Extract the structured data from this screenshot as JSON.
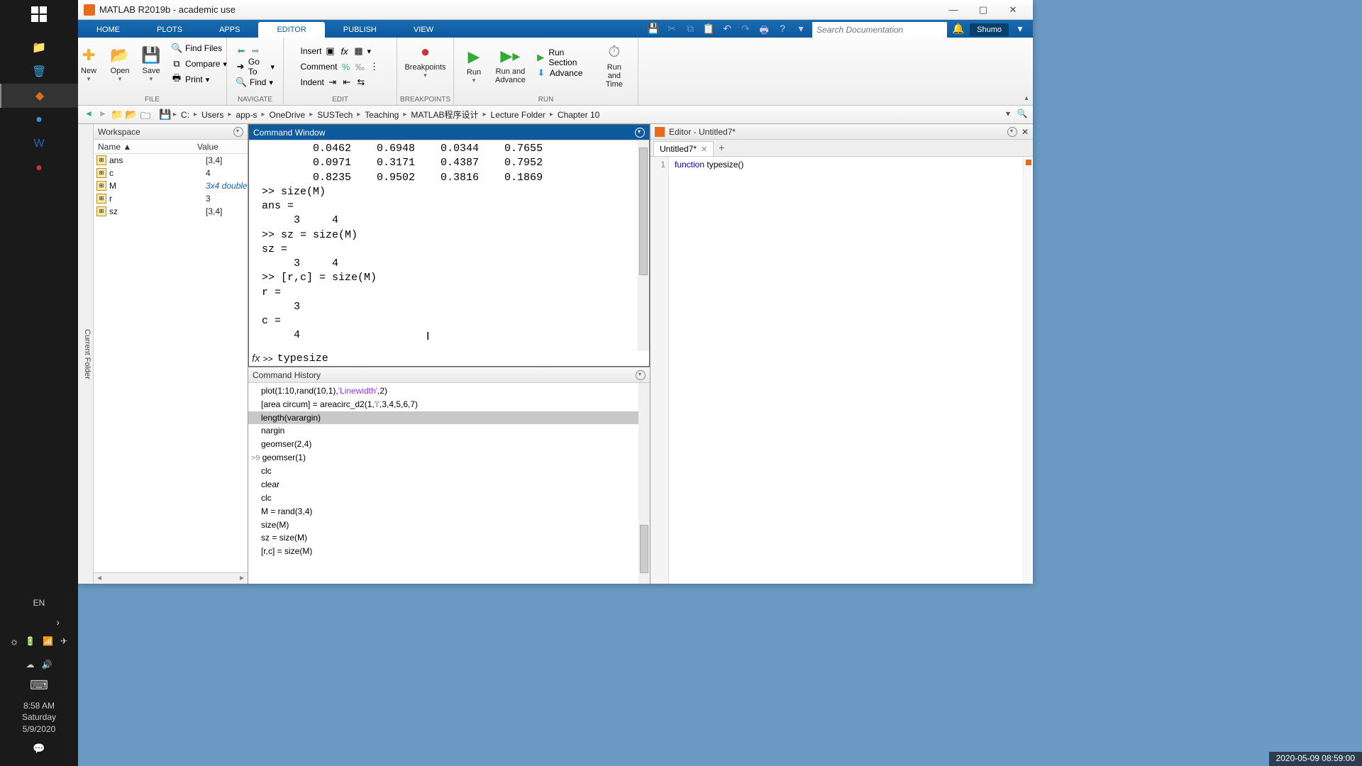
{
  "app": {
    "title": "MATLAB R2019b - academic use"
  },
  "tabs": [
    "HOME",
    "PLOTS",
    "APPS",
    "EDITOR",
    "PUBLISH",
    "VIEW"
  ],
  "active_tab": "EDITOR",
  "search_placeholder": "Search Documentation",
  "user": "Shumo",
  "ribbon": {
    "file": {
      "label": "FILE",
      "new": "New",
      "open": "Open",
      "save": "Save",
      "findfiles": "Find Files",
      "compare": "Compare",
      "print": "Print"
    },
    "navigate": {
      "label": "NAVIGATE",
      "goto": "Go To",
      "find": "Find"
    },
    "edit": {
      "label": "EDIT",
      "insert": "Insert",
      "comment": "Comment",
      "indent": "Indent"
    },
    "breakpoints": {
      "label": "BREAKPOINTS",
      "btn": "Breakpoints"
    },
    "run": {
      "label": "RUN",
      "run": "Run",
      "runadv": "Run and\nAdvance",
      "runsec": "Run Section",
      "advance": "Advance",
      "runtime": "Run and\nTime"
    }
  },
  "breadcrumbs": [
    "C:",
    "Users",
    "app-s",
    "OneDrive",
    "SUSTech",
    "Teaching",
    "MATLAB程序设计",
    "Lecture Folder",
    "Chapter 10"
  ],
  "current_folder_label": "Current Folder",
  "workspace": {
    "title": "Workspace",
    "cols": [
      "Name ▲",
      "Value"
    ],
    "rows": [
      {
        "name": "ans",
        "value": "[3,4]"
      },
      {
        "name": "c",
        "value": "4"
      },
      {
        "name": "M",
        "value": "3x4 double",
        "italic": true
      },
      {
        "name": "r",
        "value": "3"
      },
      {
        "name": "sz",
        "value": "[3,4]"
      }
    ]
  },
  "command_window": {
    "title": "Command Window",
    "lines": [
      "        0.0462    0.6948    0.0344    0.7655",
      "        0.0971    0.3171    0.4387    0.7952",
      "        0.8235    0.9502    0.3816    0.1869",
      ">> size(M)",
      "ans =",
      "     3     4",
      ">> sz = size(M)",
      "sz =",
      "     3     4",
      ">> [r,c] = size(M)",
      "r =",
      "     3",
      "c =",
      "     4"
    ],
    "input_prefix": ">>",
    "input_value": "typesize"
  },
  "command_history": {
    "title": "Command History",
    "items": [
      {
        "text": "plot(1:10,rand(10,1),'Linewidth',2)",
        "strings": [
          "'Linewidth'"
        ]
      },
      {
        "text": "[area circum] = areacirc_d2(1,'i',3,4,5,6,7)",
        "strings": [
          "'i'"
        ]
      },
      {
        "text": "length(varargin)",
        "selected": true
      },
      {
        "text": "nargin"
      },
      {
        "text": "geomser(2,4)"
      },
      {
        "text": "geomser(1)",
        "prefix": ">9"
      },
      {
        "text": "clc"
      },
      {
        "text": "clear"
      },
      {
        "text": "clc"
      },
      {
        "text": "M = rand(3,4)"
      },
      {
        "text": "size(M)"
      },
      {
        "text": "sz = size(M)"
      },
      {
        "text": "[r,c] = size(M)"
      }
    ]
  },
  "editor": {
    "panel": "Editor - Untitled7*",
    "tab": "Untitled7*",
    "line_no": "1",
    "code_kw": "function",
    "code_rest": " typesize()"
  },
  "statusbar_time": "2020-05-09 08:59:00",
  "winbar": {
    "lang": "EN",
    "time": "8:58 AM",
    "day": "Saturday",
    "date": "5/9/2020"
  }
}
